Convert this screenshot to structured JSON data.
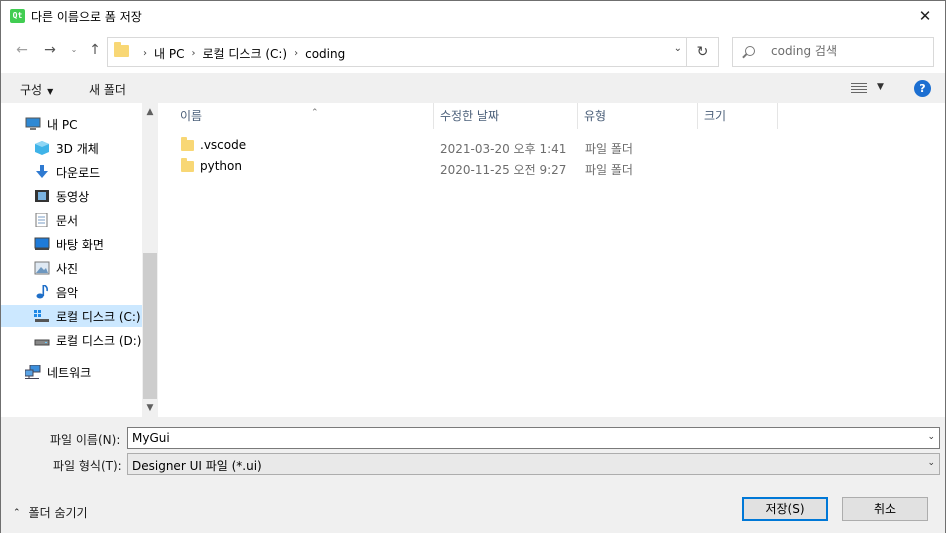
{
  "window": {
    "title": "다른 이름으로 폼 저장",
    "app_icon_text": "Qt"
  },
  "address": {
    "crumbs": [
      "내 PC",
      "로컬 디스크 (C:)",
      "coding"
    ]
  },
  "search": {
    "placeholder": "coding 검색"
  },
  "toolbar": {
    "organize": "구성",
    "new_folder": "새 폴더"
  },
  "sidebar": {
    "items": [
      {
        "label": "내 PC",
        "icon": "computer-icon"
      },
      {
        "label": "3D 개체",
        "icon": "3d-objects-icon"
      },
      {
        "label": "다운로드",
        "icon": "download-icon"
      },
      {
        "label": "동영상",
        "icon": "video-icon"
      },
      {
        "label": "문서",
        "icon": "document-icon"
      },
      {
        "label": "바탕 화면",
        "icon": "desktop-icon"
      },
      {
        "label": "사진",
        "icon": "pictures-icon"
      },
      {
        "label": "음악",
        "icon": "music-icon"
      },
      {
        "label": "로컬 디스크 (C:)",
        "icon": "drive-c-icon",
        "selected": true
      },
      {
        "label": "로컬 디스크 (D:)",
        "icon": "drive-d-icon"
      },
      {
        "label": "네트워크",
        "icon": "network-icon"
      }
    ]
  },
  "columns": {
    "name": "이름",
    "date": "수정한 날짜",
    "type": "유형",
    "size": "크기"
  },
  "files": [
    {
      "name": ".vscode",
      "date": "2021-03-20 오후 1:41",
      "type": "파일 폴더"
    },
    {
      "name": "python",
      "date": "2020-11-25 오전 9:27",
      "type": "파일 폴더"
    }
  ],
  "bottom": {
    "filename_label": "파일 이름(N):",
    "filename_value": "MyGui",
    "filetype_label": "파일 형식(T):",
    "filetype_value": "Designer UI 파일 (*.ui)",
    "hide_folders": "폴더 숨기기",
    "save": "저장(S)",
    "cancel": "취소"
  }
}
